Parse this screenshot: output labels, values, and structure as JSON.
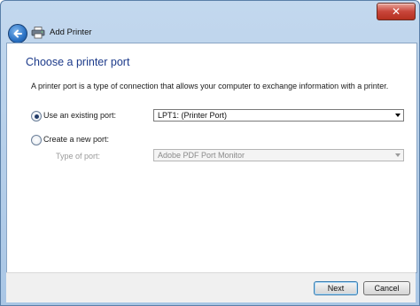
{
  "window": {
    "title": "Add Printer",
    "close_glyph": "✕"
  },
  "page": {
    "heading": "Choose a printer port",
    "description": "A printer port is a type of connection that allows your computer to exchange information with a printer."
  },
  "options": {
    "existing": {
      "label": "Use an existing port:",
      "selected": true,
      "value": "LPT1: (Printer Port)"
    },
    "new": {
      "label": "Create a new port:",
      "selected": false,
      "type_label": "Type of port:",
      "type_value": "Adobe PDF Port Monitor"
    }
  },
  "buttons": {
    "next": "Next",
    "cancel": "Cancel"
  },
  "icons": {
    "back": "back-arrow-icon",
    "printer": "printer-icon",
    "close": "close-icon"
  }
}
